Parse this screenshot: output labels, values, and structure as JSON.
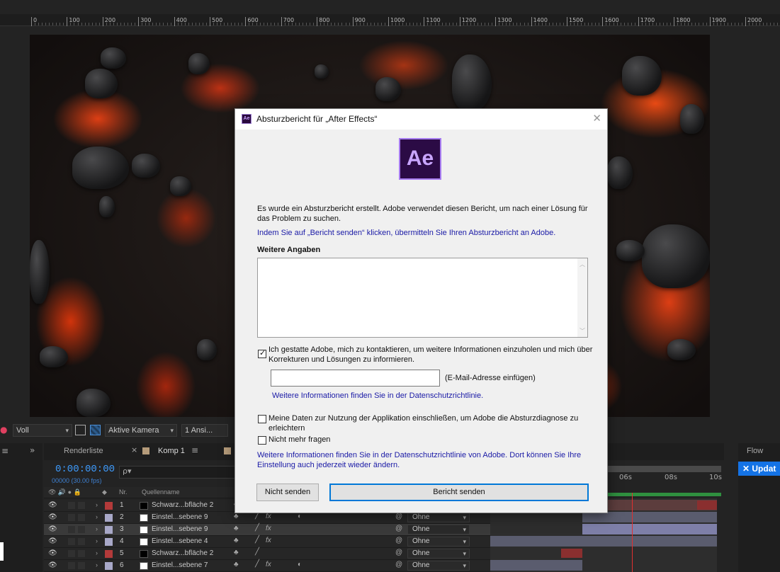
{
  "ruler": {
    "labels": [
      "0",
      "100",
      "200",
      "300",
      "400",
      "500",
      "600",
      "700",
      "800",
      "900",
      "1000",
      "1100",
      "1200",
      "1300",
      "1400",
      "1500",
      "1600",
      "1700",
      "1800",
      "1900",
      "2000"
    ]
  },
  "viewer_toolbar": {
    "resolution": "Voll",
    "camera": "Aktive Kamera",
    "views": "1 Ansi..."
  },
  "panels": {
    "renderliste_tab": "Renderliste",
    "komp_tab": "Komp 1",
    "flow_tab": "Flow",
    "update_button": "✕ Updat"
  },
  "timeline": {
    "timecode": "0:00:00:00",
    "fps": "00000 (30.00 fps)",
    "search_placeholder": "ρ▾",
    "col_nr": "Nr.",
    "col_source": "Quellenname",
    "time_labels": [
      "06s",
      "08s",
      "10s"
    ],
    "layers": [
      {
        "num": "1",
        "name": "Schwarz...bfläche 2",
        "color": "#b33a3a",
        "swatch": "#000000",
        "parent": "Ohne",
        "fx": false
      },
      {
        "num": "2",
        "name": "Einstel...sebene 9",
        "color": "#a8a8c8",
        "swatch": "#ffffff",
        "parent": "Ohne",
        "fx": true
      },
      {
        "num": "3",
        "name": "Einstel...sebene 9",
        "color": "#a8a8c8",
        "swatch": "#ffffff",
        "parent": "Ohne",
        "fx": true
      },
      {
        "num": "4",
        "name": "Einstel...sebene 4",
        "color": "#a8a8c8",
        "swatch": "#ffffff",
        "parent": "Ohne",
        "fx": true
      },
      {
        "num": "5",
        "name": "Schwarz...bfläche 2",
        "color": "#b33a3a",
        "swatch": "#000000",
        "parent": "Ohne",
        "fx": false
      },
      {
        "num": "6",
        "name": "Einstel...sebene 7",
        "color": "#a8a8c8",
        "swatch": "#ffffff",
        "parent": "Ohne",
        "fx": true
      }
    ]
  },
  "dialog": {
    "title": "Absturzbericht für „After Effects“",
    "app_icon": "Ae",
    "intro": "Es wurde ein Absturzbericht erstellt. Adobe verwendet diesen Bericht, um nach einer Lösung für das Problem zu suchen.",
    "send_info": "Indem Sie auf „Bericht senden“ klicken, übermitteln Sie Ihren Absturzbericht an Adobe.",
    "details_heading": "Weitere Angaben",
    "details_value": "",
    "contact_label": "Ich gestatte Adobe, mich zu kontaktieren, um weitere Informationen einzuholen und mich über Korrekturen und Lösungen zu informieren.",
    "contact_checked": true,
    "email_value": "",
    "email_hint": "(E-Mail-Adresse einfügen)",
    "privacy_link_1": "Weitere Informationen finden Sie in der Datenschutzrichtlinie.",
    "include_data_label": "Meine Daten zur Nutzung der Applikation einschließen, um Adobe die Absturzdiagnose zu erleichtern",
    "include_data_checked": false,
    "dont_ask_label": "Nicht mehr fragen",
    "dont_ask_checked": false,
    "privacy_link_2": "Weitere Informationen finden Sie in der Datenschutzrichtlinie von Adobe. Dort können Sie Ihre Einstellung auch jederzeit wieder ändern.",
    "dont_send_button": "Nicht senden",
    "send_button": "Bericht senden"
  }
}
